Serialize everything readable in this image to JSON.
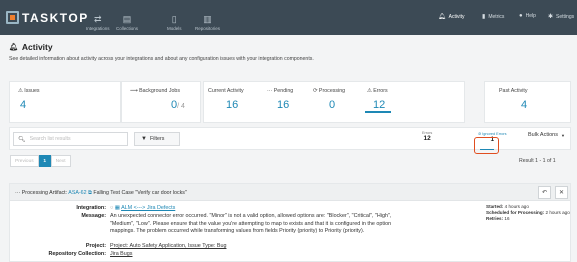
{
  "brand": {
    "name": "TASKTOP"
  },
  "nav": {
    "items": [
      {
        "label": "Integrations",
        "icon": "integrations-icon"
      },
      {
        "label": "Collections",
        "icon": "collections-icon"
      },
      {
        "label": "Models",
        "icon": "models-icon"
      },
      {
        "label": "Repositories",
        "icon": "repositories-icon"
      }
    ],
    "right": [
      {
        "label": "Activity",
        "icon": "bell-icon"
      },
      {
        "label": "Metrics",
        "icon": "chart-icon"
      },
      {
        "label": "Help",
        "icon": "help-icon"
      },
      {
        "label": "Settings",
        "icon": "gear-icon"
      }
    ]
  },
  "page": {
    "title": "Activity",
    "description": "See detailed information about activity across your integrations and about any configuration issues with your integration components."
  },
  "stats": {
    "issues": {
      "label": "Issues",
      "value": "4"
    },
    "background_jobs": {
      "label": "Background Jobs",
      "value": "0",
      "total": "/ 4"
    },
    "current_activity": {
      "label": "Current Activity",
      "value": "16"
    },
    "pending": {
      "label": "Pending",
      "value": "16"
    },
    "processing": {
      "label": "Processing",
      "value": "0"
    },
    "errors": {
      "label": "Errors",
      "value": "12"
    },
    "past_activity": {
      "label": "Past Activity",
      "value": "4"
    }
  },
  "toolbar": {
    "search_placeholder": "Search list results",
    "filters_label": "Filters",
    "errors_mini_label": "Errors",
    "errors_mini_value": "12",
    "ignored_label": "Ignored Errors",
    "ignored_value": "1",
    "bulk_label": "Bulk Actions"
  },
  "pagination": {
    "previous": "Previous",
    "current": "1",
    "next": "Next",
    "result_text": "Result 1 - 1 of 1"
  },
  "item": {
    "title_prefix": "Processing Artifact:",
    "artifact_id": "ASA-62",
    "title_suffix": "Falling Test Case \"Verify car door locks\"",
    "integration_label": "Integration:",
    "integration_value": "ALM <---> Jira Defects",
    "message_label": "Message:",
    "message_value": "An unexpected connector error occurred. \"Minor\" is not a valid option, allowed options are: \"Blocker\", \"Critical\", \"High\", \"Medium\", \"Low\". Please ensure that the value you're attempting to map to exists and that it is configured in the option mappings. The problem occurred while transforming values from fields Priority (priority) to Priority (priority).",
    "project_label": "Project:",
    "project_value": "Project: Auto Safety Application, Issue Type: Bug",
    "repo_label": "Repository Collection:",
    "repo_value": "Jira Bugs",
    "started_label": "Started:",
    "started_value": "4 hours ago",
    "scheduled_label": "Scheduled for Processing:",
    "scheduled_value": "2 hours ago",
    "retries_label": "Retries:",
    "retries_value": "16"
  }
}
